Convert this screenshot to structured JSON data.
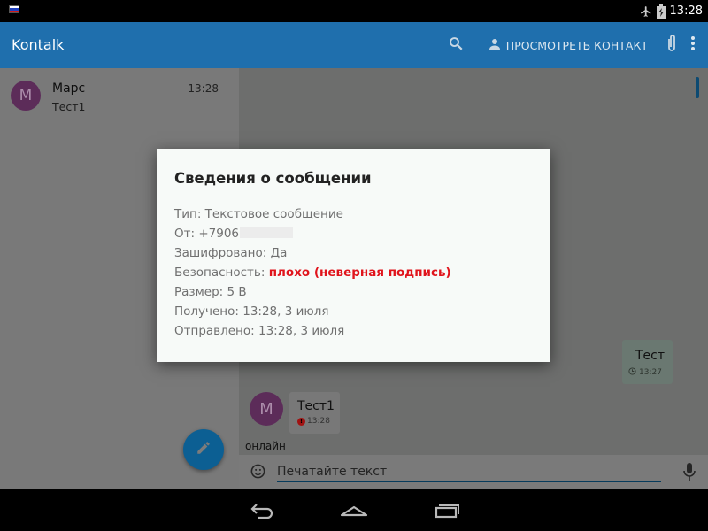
{
  "status_bar": {
    "time": "13:28",
    "icons": [
      "flag-icon",
      "airplane-mode-icon",
      "battery-charging-icon"
    ],
    "flag_colors": [
      "#ffffff",
      "#1e3fbf",
      "#d21b1b"
    ]
  },
  "app_bar": {
    "title": "Kontalk",
    "view_contact_label": "ПРОСМОТРЕТЬ КОНТАКТ",
    "icons": [
      "search-icon",
      "person-icon",
      "attach-icon",
      "overflow-menu-icon"
    ],
    "color": "#1f6fad"
  },
  "conversations": [
    {
      "avatar_letter": "M",
      "name": "Марс",
      "preview": "Тест1",
      "time": "13:28"
    }
  ],
  "chat": {
    "outgoing_message": {
      "text": "Тест",
      "time": "13:27",
      "status_icon": "clock-icon"
    },
    "incoming_message": {
      "avatar_letter": "M",
      "text": "Тест1",
      "time": "13:28",
      "status_icon": "error-icon"
    },
    "presence": "онлайн",
    "input": {
      "placeholder": "Печатайте текст",
      "value": ""
    },
    "icons": [
      "emoji-icon",
      "mic-icon",
      "compose-icon"
    ]
  },
  "dialog": {
    "title": "Сведения о сообщении",
    "type": "Тип: Текстовое сообщение",
    "from": "От: +7906",
    "encrypted": "Зашифровано: Да",
    "security_label": "Безопасность: ",
    "security_value": "плохо (неверная подпись)",
    "size": "Размер: 5 B",
    "received": "Получено: 13:28, 3 июля",
    "sent": "Отправлено: 13:28, 3 июля",
    "security_color": "#e0141c"
  },
  "nav_bar": {
    "icons": [
      "back-icon",
      "home-icon",
      "recents-icon"
    ]
  }
}
